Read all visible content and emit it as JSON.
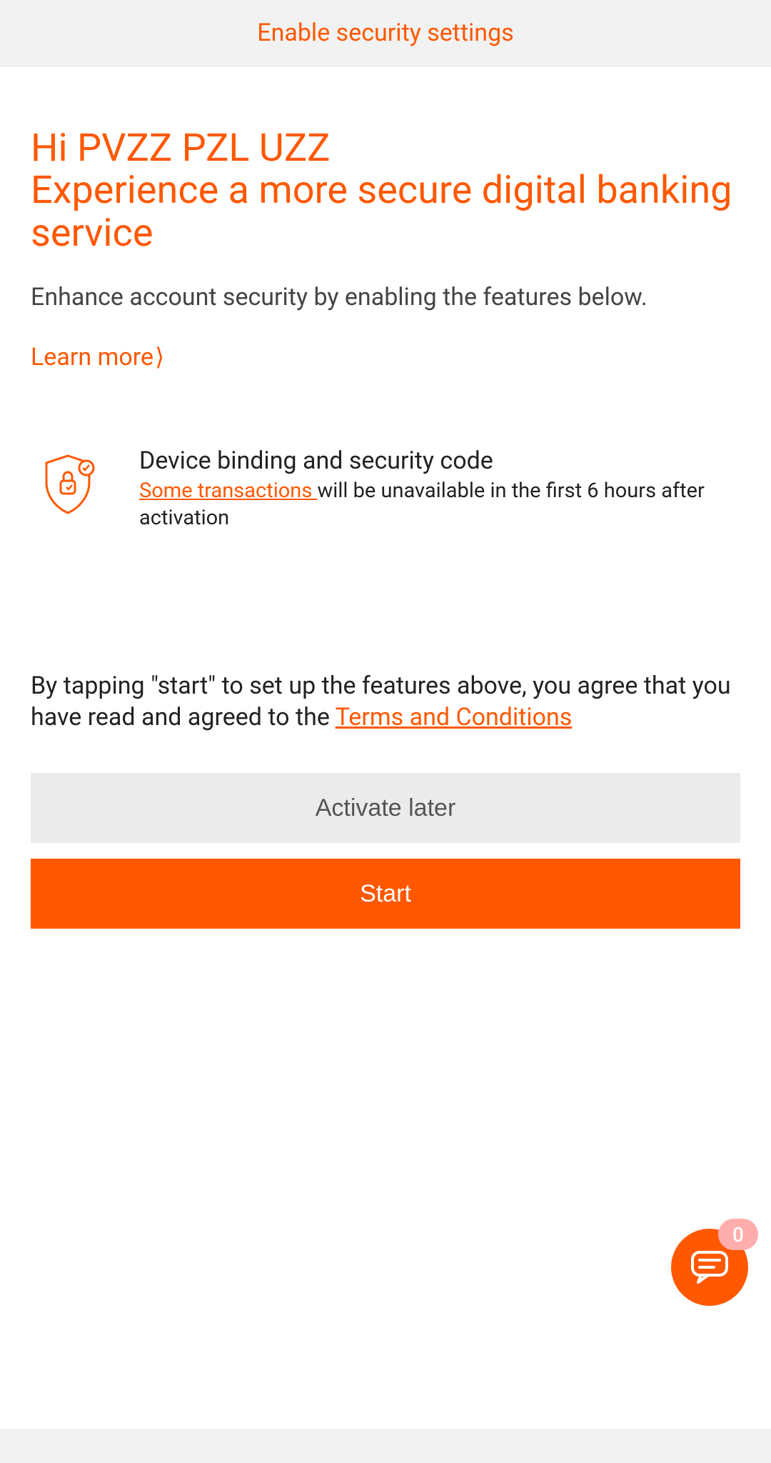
{
  "header": {
    "title": "Enable security settings"
  },
  "greeting": {
    "line1": "Hi PVZZ PZL UZZ",
    "line2": "Experience a more secure digital banking service"
  },
  "subtitle": "Enhance account security by enabling the features below.",
  "learn_more": {
    "label": "Learn more",
    "arrow": "⟩"
  },
  "feature": {
    "title": "Device binding and security code",
    "desc_link": "Some transactions ",
    "desc_rest": "will be unavailable in the first 6 hours after activation"
  },
  "terms": {
    "text": "By tapping \"start\" to set up the features above, you agree that you have read and agreed to the ",
    "link": "Terms and Conditions"
  },
  "buttons": {
    "later": "Activate later",
    "start": "Start"
  },
  "chat": {
    "badge": "0"
  },
  "colors": {
    "accent": "#ff5800"
  }
}
